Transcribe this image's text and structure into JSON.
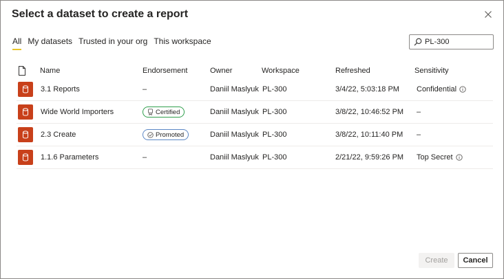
{
  "dialog": {
    "title": "Select a dataset to create a report"
  },
  "tabs": [
    {
      "label": "All",
      "active": true
    },
    {
      "label": "My datasets",
      "active": false
    },
    {
      "label": "Trusted in your org",
      "active": false
    },
    {
      "label": "This workspace",
      "active": false
    }
  ],
  "search": {
    "value": "PL-300"
  },
  "columns": {
    "name": "Name",
    "endorsement": "Endorsement",
    "owner": "Owner",
    "workspace": "Workspace",
    "refreshed": "Refreshed",
    "sensitivity": "Sensitivity"
  },
  "rows": [
    {
      "name": "3.1 Reports",
      "endorsement": "–",
      "owner": "Daniil Maslyuk",
      "workspace": "PL-300",
      "refreshed": "3/4/22, 5:03:18 PM",
      "sensitivity": "Confidential"
    },
    {
      "name": "Wide World Importers",
      "endorsement": "Certified",
      "owner": "Daniil Maslyuk",
      "workspace": "PL-300",
      "refreshed": "3/8/22, 10:46:52 PM",
      "sensitivity": "–"
    },
    {
      "name": "2.3 Create",
      "endorsement": "Promoted",
      "owner": "Daniil Maslyuk",
      "workspace": "PL-300",
      "refreshed": "3/8/22, 10:11:40 PM",
      "sensitivity": "–"
    },
    {
      "name": "1.1.6 Parameters",
      "endorsement": "–",
      "owner": "Daniil Maslyuk",
      "workspace": "PL-300",
      "refreshed": "2/21/22, 9:59:26 PM",
      "sensitivity": "Top Secret"
    }
  ],
  "footer": {
    "create_label": "Create",
    "cancel_label": "Cancel"
  },
  "colors": {
    "dataset_icon": "#c8401a",
    "active_tab_underline": "#e8c42a",
    "certified_border": "#2e9e4b",
    "promoted_border": "#5b87c5"
  }
}
